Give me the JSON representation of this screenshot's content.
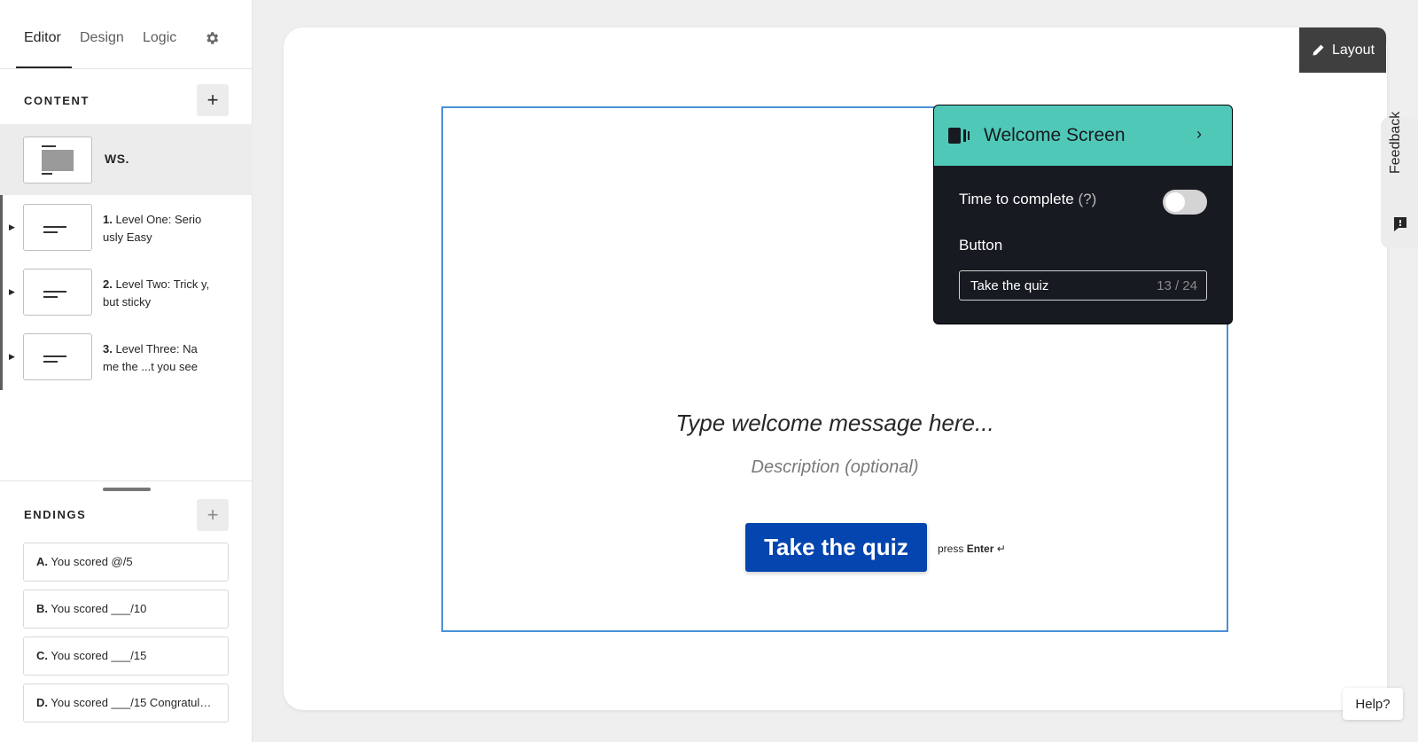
{
  "tabs": [
    {
      "label": "Editor",
      "active": true
    },
    {
      "label": "Design",
      "active": false
    },
    {
      "label": "Logic",
      "active": false
    }
  ],
  "content": {
    "section_label": "CONTENT",
    "add_label": "+",
    "welcome_item": {
      "label": "WS."
    },
    "questions": [
      {
        "num": "1.",
        "text": " Level One: Serio usly Easy"
      },
      {
        "num": "2.",
        "text": " Level Two: Trick y, but sticky"
      },
      {
        "num": "3.",
        "text": " Level Three: Na me the ...t you see"
      }
    ]
  },
  "endings": {
    "section_label": "ENDINGS",
    "add_label": "+",
    "items": [
      {
        "letter": "A.",
        "text": " You scored @/5"
      },
      {
        "letter": "B.",
        "text": " You scored ___/10"
      },
      {
        "letter": "C.",
        "text": " You scored ___/15"
      },
      {
        "letter": "D.",
        "text": " You scored ___/15 Congratula..."
      }
    ]
  },
  "toolbar": {
    "layout_label": "Layout"
  },
  "welcome": {
    "title": "Type welcome message here...",
    "description": "Description (optional)",
    "button_label": "Take the quiz",
    "press_text": "press",
    "press_key": "Enter",
    "enter_symbol": "↵"
  },
  "popover": {
    "title": "Welcome Screen",
    "chevron": "›",
    "time_label": "Time to complete",
    "time_hint": "(?)",
    "time_enabled": false,
    "button_section_label": "Button",
    "button_value": "Take the quiz",
    "char_count": "13 / 24"
  },
  "feedback_label": "Feedback",
  "help_label": "Help?",
  "colors": {
    "accent_teal": "#50c8b8",
    "button_blue": "#0445af",
    "frame_blue": "#4a90d9",
    "popover_bg": "#171b21"
  }
}
